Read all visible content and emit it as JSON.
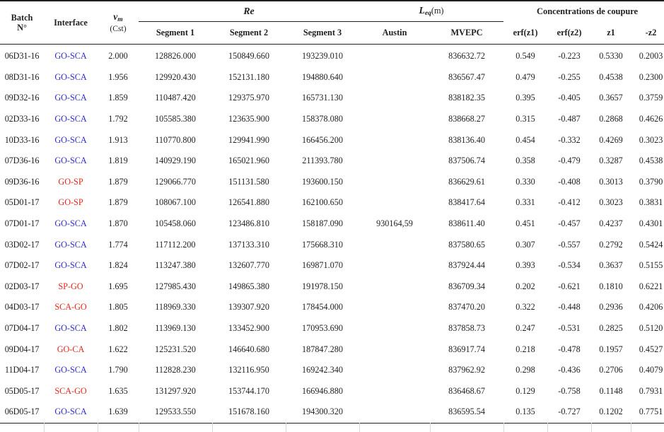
{
  "table": {
    "header": {
      "batch": {
        "line1": "Batch",
        "line2": "N°"
      },
      "interface": "Interface",
      "vm": {
        "symbol": "v",
        "subscript": "m",
        "unit": "(Cst)"
      },
      "re_group": "Re",
      "segments": [
        "Segment 1",
        "Segment 2",
        "Segment 3"
      ],
      "leq_group": {
        "symbol": "L",
        "subscript": "eq",
        "unit": "(m)"
      },
      "leq_cols": [
        "Austin",
        "MVEPC"
      ],
      "conc_group": "Concentrations  de coupure",
      "conc_cols": [
        "erf(z1)",
        "erf(z2)",
        "z1",
        "-z2"
      ]
    },
    "colors": {
      "blue_interface": "#2e2ec6",
      "red_interface": "#e0281c",
      "rule": "#231f20"
    },
    "rows": [
      {
        "batch": "06D31-16",
        "interface": "GO-SCA",
        "interface_color": "blue",
        "vm": "2.000",
        "seg1": "128826.000",
        "seg2": "150849.660",
        "seg3": "193239.010",
        "austin": "",
        "mvepc": "836632.72",
        "erf_z1": "0.549",
        "erf_z2": "-0.223",
        "z1": "0.5330",
        "z2": "0.2003"
      },
      {
        "batch": "08D31-16",
        "interface": "GO-SCA",
        "interface_color": "blue",
        "vm": "1.956",
        "seg1": "129920.430",
        "seg2": "152131.180",
        "seg3": "194880.640",
        "austin": "",
        "mvepc": "836567.47",
        "erf_z1": "0.479",
        "erf_z2": "-0.255",
        "z1": "0.4538",
        "z2": "0.2300"
      },
      {
        "batch": "09D32-16",
        "interface": "GO-SCA",
        "interface_color": "blue",
        "vm": "1.859",
        "seg1": "110487.420",
        "seg2": "129375.970",
        "seg3": "165731.130",
        "austin": "",
        "mvepc": "838182.35",
        "erf_z1": "0.395",
        "erf_z2": "-0.405",
        "z1": "0.3657",
        "z2": "0.3759"
      },
      {
        "batch": "02D33-16",
        "interface": "GO-SCA",
        "interface_color": "blue",
        "vm": "1.792",
        "seg1": "105585.380",
        "seg2": "123635.900",
        "seg3": "158378.080",
        "austin": "",
        "mvepc": "838668.27",
        "erf_z1": "0.315",
        "erf_z2": "-0.487",
        "z1": "0.2868",
        "z2": "0.4626"
      },
      {
        "batch": "10D33-16",
        "interface": "GO-SCA",
        "interface_color": "blue",
        "vm": "1.913",
        "seg1": "110770.800",
        "seg2": "129941.990",
        "seg3": "166456.200",
        "austin": "",
        "mvepc": "838136.40",
        "erf_z1": "0.454",
        "erf_z2": "-0.332",
        "z1": "0.4269",
        "z2": "0.3023"
      },
      {
        "batch": "07D36-16",
        "interface": "GO-SCA",
        "interface_color": "blue",
        "vm": "1.819",
        "seg1": "140929.190",
        "seg2": "165021.960",
        "seg3": "211393.780",
        "austin": "",
        "mvepc": "837506.74",
        "erf_z1": "0.358",
        "erf_z2": "-0.479",
        "z1": "0.3287",
        "z2": "0.4538"
      },
      {
        "batch": "09D36-16",
        "interface": "GO-SP",
        "interface_color": "red",
        "vm": "1.879",
        "seg1": "129066.770",
        "seg2": "151131.580",
        "seg3": "193600.150",
        "austin": "",
        "mvepc": "836629.61",
        "erf_z1": "0.330",
        "erf_z2": "-0.408",
        "z1": "0.3013",
        "z2": "0.3790"
      },
      {
        "batch": "05D01-17",
        "interface": "GO-SP",
        "interface_color": "red",
        "vm": "1.879",
        "seg1": "108067.100",
        "seg2": "126541.880",
        "seg3": "162100.650",
        "austin": "",
        "mvepc": "838417.64",
        "erf_z1": "0.331",
        "erf_z2": "-0.412",
        "z1": "0.3023",
        "z2": "0.3831"
      },
      {
        "batch": "07D01-17",
        "interface": "GO-SCA",
        "interface_color": "blue",
        "vm": "1.870",
        "seg1": "105458.060",
        "seg2": "123486.810",
        "seg3": "158187.090",
        "austin": "930164,59",
        "mvepc": "838611.40",
        "erf_z1": "0.451",
        "erf_z2": "-0.457",
        "z1": "0.4237",
        "z2": "0.4301"
      },
      {
        "batch": "03D02-17",
        "interface": "GO-SCA",
        "interface_color": "blue",
        "vm": "1.774",
        "seg1": "117112.200",
        "seg2": "137133.310",
        "seg3": "175668.310",
        "austin": "",
        "mvepc": "837580.65",
        "erf_z1": "0.307",
        "erf_z2": "-0.557",
        "z1": "0.2792",
        "z2": "0.5424"
      },
      {
        "batch": "07D02-17",
        "interface": "GO-SCA",
        "interface_color": "blue",
        "vm": "1.824",
        "seg1": "113247.380",
        "seg2": "132607.770",
        "seg3": "169871.070",
        "austin": "",
        "mvepc": "837924.44",
        "erf_z1": "0.393",
        "erf_z2": "-0.534",
        "z1": "0.3637",
        "z2": "0.5155"
      },
      {
        "batch": "02D03-17",
        "interface": "SP-GO",
        "interface_color": "red",
        "vm": "1.695",
        "seg1": "127985.430",
        "seg2": "149865.380",
        "seg3": "191978.150",
        "austin": "",
        "mvepc": "836709.34",
        "erf_z1": "0.202",
        "erf_z2": "-0.621",
        "z1": "0.1810",
        "z2": "0.6221"
      },
      {
        "batch": "04D03-17",
        "interface": "SCA-GO",
        "interface_color": "red",
        "vm": "1.805",
        "seg1": "118969.330",
        "seg2": "139307.920",
        "seg3": "178454.000",
        "austin": "",
        "mvepc": "837470.20",
        "erf_z1": "0.322",
        "erf_z2": "-0.448",
        "z1": "0.2936",
        "z2": "0.4206"
      },
      {
        "batch": "07D04-17",
        "interface": "GO-SCA",
        "interface_color": "blue",
        "vm": "1.802",
        "seg1": "113969.130",
        "seg2": "133452.900",
        "seg3": "170953.690",
        "austin": "",
        "mvepc": "837858.73",
        "erf_z1": "0.247",
        "erf_z2": "-0.531",
        "z1": "0.2825",
        "z2": "0.5120"
      },
      {
        "batch": "09D04-17",
        "interface": "GO-CA",
        "interface_color": "red",
        "vm": "1.622",
        "seg1": "125231.520",
        "seg2": "146640.680",
        "seg3": "187847.280",
        "austin": "",
        "mvepc": "836917.74",
        "erf_z1": "0.218",
        "erf_z2": "-0.478",
        "z1": "0.1957",
        "z2": "0.4527"
      },
      {
        "batch": "11D04-17",
        "interface": "GO-SCA",
        "interface_color": "blue",
        "vm": "1.790",
        "seg1": "112828.230",
        "seg2": "132116.950",
        "seg3": "169242.340",
        "austin": "",
        "mvepc": "837962.92",
        "erf_z1": "0.298",
        "erf_z2": "-0.436",
        "z1": "0.2706",
        "z2": "0.4079"
      },
      {
        "batch": "05D05-17",
        "interface": "SCA-GO",
        "interface_color": "red",
        "vm": "1.635",
        "seg1": "131297.920",
        "seg2": "153744.170",
        "seg3": "166946.880",
        "austin": "",
        "mvepc": "836468.67",
        "erf_z1": "0.129",
        "erf_z2": "-0.758",
        "z1": "0.1148",
        "z2": "0.7931"
      },
      {
        "batch": "06D05-17",
        "interface": "GO-SCA",
        "interface_color": "blue",
        "vm": "1.639",
        "seg1": "129533.550",
        "seg2": "151678.160",
        "seg3": "194300.320",
        "austin": "",
        "mvepc": "836595.54",
        "erf_z1": "0.135",
        "erf_z2": "-0.727",
        "z1": "0.1202",
        "z2": "0.7751"
      }
    ]
  }
}
